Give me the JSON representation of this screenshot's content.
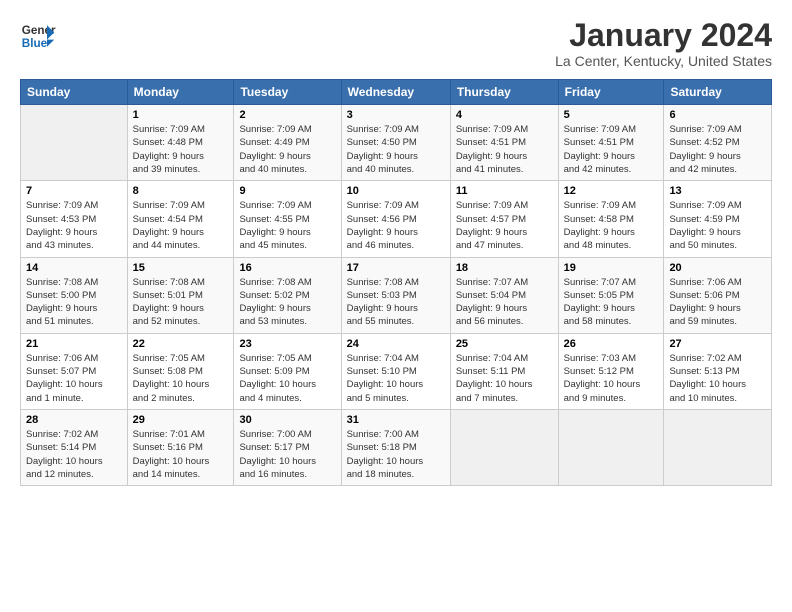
{
  "header": {
    "logo_line1": "General",
    "logo_line2": "Blue",
    "title": "January 2024",
    "subtitle": "La Center, Kentucky, United States"
  },
  "days_of_week": [
    "Sunday",
    "Monday",
    "Tuesday",
    "Wednesday",
    "Thursday",
    "Friday",
    "Saturday"
  ],
  "weeks": [
    [
      {
        "day": "",
        "info": ""
      },
      {
        "day": "1",
        "info": "Sunrise: 7:09 AM\nSunset: 4:48 PM\nDaylight: 9 hours\nand 39 minutes."
      },
      {
        "day": "2",
        "info": "Sunrise: 7:09 AM\nSunset: 4:49 PM\nDaylight: 9 hours\nand 40 minutes."
      },
      {
        "day": "3",
        "info": "Sunrise: 7:09 AM\nSunset: 4:50 PM\nDaylight: 9 hours\nand 40 minutes."
      },
      {
        "day": "4",
        "info": "Sunrise: 7:09 AM\nSunset: 4:51 PM\nDaylight: 9 hours\nand 41 minutes."
      },
      {
        "day": "5",
        "info": "Sunrise: 7:09 AM\nSunset: 4:51 PM\nDaylight: 9 hours\nand 42 minutes."
      },
      {
        "day": "6",
        "info": "Sunrise: 7:09 AM\nSunset: 4:52 PM\nDaylight: 9 hours\nand 42 minutes."
      }
    ],
    [
      {
        "day": "7",
        "info": "Sunrise: 7:09 AM\nSunset: 4:53 PM\nDaylight: 9 hours\nand 43 minutes."
      },
      {
        "day": "8",
        "info": "Sunrise: 7:09 AM\nSunset: 4:54 PM\nDaylight: 9 hours\nand 44 minutes."
      },
      {
        "day": "9",
        "info": "Sunrise: 7:09 AM\nSunset: 4:55 PM\nDaylight: 9 hours\nand 45 minutes."
      },
      {
        "day": "10",
        "info": "Sunrise: 7:09 AM\nSunset: 4:56 PM\nDaylight: 9 hours\nand 46 minutes."
      },
      {
        "day": "11",
        "info": "Sunrise: 7:09 AM\nSunset: 4:57 PM\nDaylight: 9 hours\nand 47 minutes."
      },
      {
        "day": "12",
        "info": "Sunrise: 7:09 AM\nSunset: 4:58 PM\nDaylight: 9 hours\nand 48 minutes."
      },
      {
        "day": "13",
        "info": "Sunrise: 7:09 AM\nSunset: 4:59 PM\nDaylight: 9 hours\nand 50 minutes."
      }
    ],
    [
      {
        "day": "14",
        "info": "Sunrise: 7:08 AM\nSunset: 5:00 PM\nDaylight: 9 hours\nand 51 minutes."
      },
      {
        "day": "15",
        "info": "Sunrise: 7:08 AM\nSunset: 5:01 PM\nDaylight: 9 hours\nand 52 minutes."
      },
      {
        "day": "16",
        "info": "Sunrise: 7:08 AM\nSunset: 5:02 PM\nDaylight: 9 hours\nand 53 minutes."
      },
      {
        "day": "17",
        "info": "Sunrise: 7:08 AM\nSunset: 5:03 PM\nDaylight: 9 hours\nand 55 minutes."
      },
      {
        "day": "18",
        "info": "Sunrise: 7:07 AM\nSunset: 5:04 PM\nDaylight: 9 hours\nand 56 minutes."
      },
      {
        "day": "19",
        "info": "Sunrise: 7:07 AM\nSunset: 5:05 PM\nDaylight: 9 hours\nand 58 minutes."
      },
      {
        "day": "20",
        "info": "Sunrise: 7:06 AM\nSunset: 5:06 PM\nDaylight: 9 hours\nand 59 minutes."
      }
    ],
    [
      {
        "day": "21",
        "info": "Sunrise: 7:06 AM\nSunset: 5:07 PM\nDaylight: 10 hours\nand 1 minute."
      },
      {
        "day": "22",
        "info": "Sunrise: 7:05 AM\nSunset: 5:08 PM\nDaylight: 10 hours\nand 2 minutes."
      },
      {
        "day": "23",
        "info": "Sunrise: 7:05 AM\nSunset: 5:09 PM\nDaylight: 10 hours\nand 4 minutes."
      },
      {
        "day": "24",
        "info": "Sunrise: 7:04 AM\nSunset: 5:10 PM\nDaylight: 10 hours\nand 5 minutes."
      },
      {
        "day": "25",
        "info": "Sunrise: 7:04 AM\nSunset: 5:11 PM\nDaylight: 10 hours\nand 7 minutes."
      },
      {
        "day": "26",
        "info": "Sunrise: 7:03 AM\nSunset: 5:12 PM\nDaylight: 10 hours\nand 9 minutes."
      },
      {
        "day": "27",
        "info": "Sunrise: 7:02 AM\nSunset: 5:13 PM\nDaylight: 10 hours\nand 10 minutes."
      }
    ],
    [
      {
        "day": "28",
        "info": "Sunrise: 7:02 AM\nSunset: 5:14 PM\nDaylight: 10 hours\nand 12 minutes."
      },
      {
        "day": "29",
        "info": "Sunrise: 7:01 AM\nSunset: 5:16 PM\nDaylight: 10 hours\nand 14 minutes."
      },
      {
        "day": "30",
        "info": "Sunrise: 7:00 AM\nSunset: 5:17 PM\nDaylight: 10 hours\nand 16 minutes."
      },
      {
        "day": "31",
        "info": "Sunrise: 7:00 AM\nSunset: 5:18 PM\nDaylight: 10 hours\nand 18 minutes."
      },
      {
        "day": "",
        "info": ""
      },
      {
        "day": "",
        "info": ""
      },
      {
        "day": "",
        "info": ""
      }
    ]
  ]
}
